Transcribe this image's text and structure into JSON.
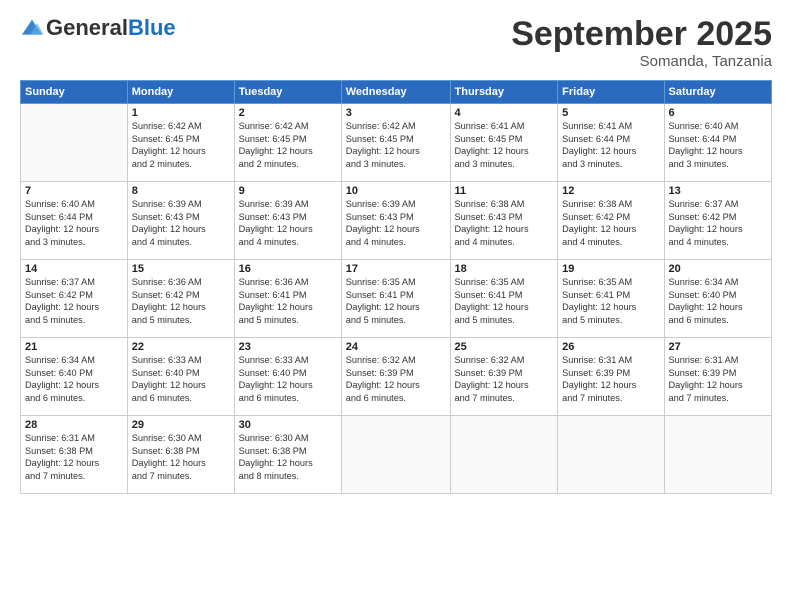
{
  "header": {
    "logo": {
      "general": "General",
      "blue": "Blue"
    },
    "title": "September 2025",
    "subtitle": "Somanda, Tanzania"
  },
  "calendar": {
    "days_of_week": [
      "Sunday",
      "Monday",
      "Tuesday",
      "Wednesday",
      "Thursday",
      "Friday",
      "Saturday"
    ],
    "weeks": [
      [
        {
          "day": "",
          "info": ""
        },
        {
          "day": "1",
          "info": "Sunrise: 6:42 AM\nSunset: 6:45 PM\nDaylight: 12 hours\nand 2 minutes."
        },
        {
          "day": "2",
          "info": "Sunrise: 6:42 AM\nSunset: 6:45 PM\nDaylight: 12 hours\nand 2 minutes."
        },
        {
          "day": "3",
          "info": "Sunrise: 6:42 AM\nSunset: 6:45 PM\nDaylight: 12 hours\nand 3 minutes."
        },
        {
          "day": "4",
          "info": "Sunrise: 6:41 AM\nSunset: 6:45 PM\nDaylight: 12 hours\nand 3 minutes."
        },
        {
          "day": "5",
          "info": "Sunrise: 6:41 AM\nSunset: 6:44 PM\nDaylight: 12 hours\nand 3 minutes."
        },
        {
          "day": "6",
          "info": "Sunrise: 6:40 AM\nSunset: 6:44 PM\nDaylight: 12 hours\nand 3 minutes."
        }
      ],
      [
        {
          "day": "7",
          "info": "Sunrise: 6:40 AM\nSunset: 6:44 PM\nDaylight: 12 hours\nand 3 minutes."
        },
        {
          "day": "8",
          "info": "Sunrise: 6:39 AM\nSunset: 6:43 PM\nDaylight: 12 hours\nand 4 minutes."
        },
        {
          "day": "9",
          "info": "Sunrise: 6:39 AM\nSunset: 6:43 PM\nDaylight: 12 hours\nand 4 minutes."
        },
        {
          "day": "10",
          "info": "Sunrise: 6:39 AM\nSunset: 6:43 PM\nDaylight: 12 hours\nand 4 minutes."
        },
        {
          "day": "11",
          "info": "Sunrise: 6:38 AM\nSunset: 6:43 PM\nDaylight: 12 hours\nand 4 minutes."
        },
        {
          "day": "12",
          "info": "Sunrise: 6:38 AM\nSunset: 6:42 PM\nDaylight: 12 hours\nand 4 minutes."
        },
        {
          "day": "13",
          "info": "Sunrise: 6:37 AM\nSunset: 6:42 PM\nDaylight: 12 hours\nand 4 minutes."
        }
      ],
      [
        {
          "day": "14",
          "info": "Sunrise: 6:37 AM\nSunset: 6:42 PM\nDaylight: 12 hours\nand 5 minutes."
        },
        {
          "day": "15",
          "info": "Sunrise: 6:36 AM\nSunset: 6:42 PM\nDaylight: 12 hours\nand 5 minutes."
        },
        {
          "day": "16",
          "info": "Sunrise: 6:36 AM\nSunset: 6:41 PM\nDaylight: 12 hours\nand 5 minutes."
        },
        {
          "day": "17",
          "info": "Sunrise: 6:35 AM\nSunset: 6:41 PM\nDaylight: 12 hours\nand 5 minutes."
        },
        {
          "day": "18",
          "info": "Sunrise: 6:35 AM\nSunset: 6:41 PM\nDaylight: 12 hours\nand 5 minutes."
        },
        {
          "day": "19",
          "info": "Sunrise: 6:35 AM\nSunset: 6:41 PM\nDaylight: 12 hours\nand 5 minutes."
        },
        {
          "day": "20",
          "info": "Sunrise: 6:34 AM\nSunset: 6:40 PM\nDaylight: 12 hours\nand 6 minutes."
        }
      ],
      [
        {
          "day": "21",
          "info": "Sunrise: 6:34 AM\nSunset: 6:40 PM\nDaylight: 12 hours\nand 6 minutes."
        },
        {
          "day": "22",
          "info": "Sunrise: 6:33 AM\nSunset: 6:40 PM\nDaylight: 12 hours\nand 6 minutes."
        },
        {
          "day": "23",
          "info": "Sunrise: 6:33 AM\nSunset: 6:40 PM\nDaylight: 12 hours\nand 6 minutes."
        },
        {
          "day": "24",
          "info": "Sunrise: 6:32 AM\nSunset: 6:39 PM\nDaylight: 12 hours\nand 6 minutes."
        },
        {
          "day": "25",
          "info": "Sunrise: 6:32 AM\nSunset: 6:39 PM\nDaylight: 12 hours\nand 7 minutes."
        },
        {
          "day": "26",
          "info": "Sunrise: 6:31 AM\nSunset: 6:39 PM\nDaylight: 12 hours\nand 7 minutes."
        },
        {
          "day": "27",
          "info": "Sunrise: 6:31 AM\nSunset: 6:39 PM\nDaylight: 12 hours\nand 7 minutes."
        }
      ],
      [
        {
          "day": "28",
          "info": "Sunrise: 6:31 AM\nSunset: 6:38 PM\nDaylight: 12 hours\nand 7 minutes."
        },
        {
          "day": "29",
          "info": "Sunrise: 6:30 AM\nSunset: 6:38 PM\nDaylight: 12 hours\nand 7 minutes."
        },
        {
          "day": "30",
          "info": "Sunrise: 6:30 AM\nSunset: 6:38 PM\nDaylight: 12 hours\nand 8 minutes."
        },
        {
          "day": "",
          "info": ""
        },
        {
          "day": "",
          "info": ""
        },
        {
          "day": "",
          "info": ""
        },
        {
          "day": "",
          "info": ""
        }
      ]
    ]
  }
}
